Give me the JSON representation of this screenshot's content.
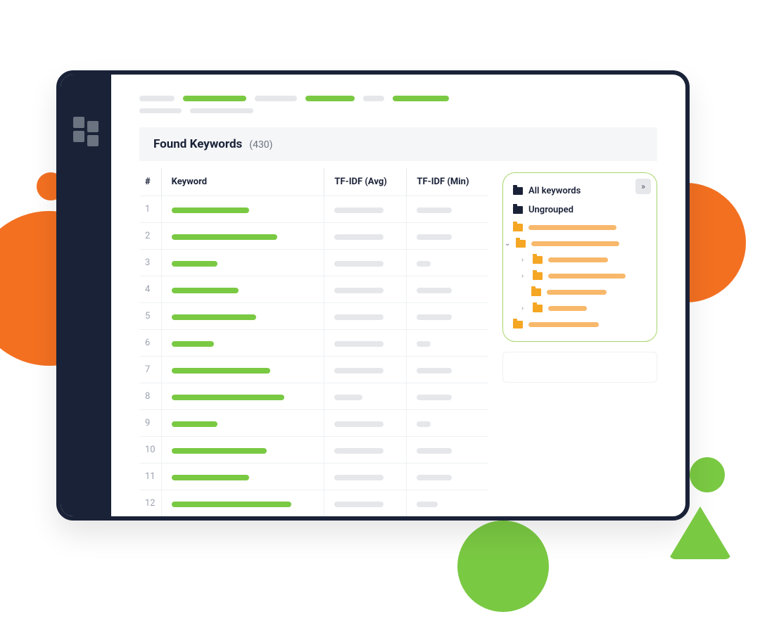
{
  "header": {
    "title": "Found Keywords",
    "count": "(430)"
  },
  "columns": {
    "num": "#",
    "keyword": "Keyword",
    "avg": "TF-IDF (Avg)",
    "min": "TF-IDF (Min)"
  },
  "rows": [
    {
      "n": "1",
      "kw": 110,
      "avg": 70,
      "min": 50
    },
    {
      "n": "2",
      "kw": 150,
      "avg": 70,
      "min": 50
    },
    {
      "n": "3",
      "kw": 65,
      "avg": 70,
      "min": 20
    },
    {
      "n": "4",
      "kw": 95,
      "avg": 70,
      "min": 50
    },
    {
      "n": "5",
      "kw": 120,
      "avg": 70,
      "min": 50
    },
    {
      "n": "6",
      "kw": 60,
      "avg": 70,
      "min": 20
    },
    {
      "n": "7",
      "kw": 140,
      "avg": 70,
      "min": 50
    },
    {
      "n": "8",
      "kw": 160,
      "avg": 40,
      "min": 50
    },
    {
      "n": "9",
      "kw": 65,
      "avg": 70,
      "min": 20
    },
    {
      "n": "10",
      "kw": 135,
      "avg": 70,
      "min": 50
    },
    {
      "n": "11",
      "kw": 110,
      "avg": 70,
      "min": 50
    },
    {
      "n": "12",
      "kw": 170,
      "avg": 70,
      "min": 30
    }
  ],
  "sidepanel": {
    "all": "All keywords",
    "ungrouped": "Ungrouped"
  }
}
